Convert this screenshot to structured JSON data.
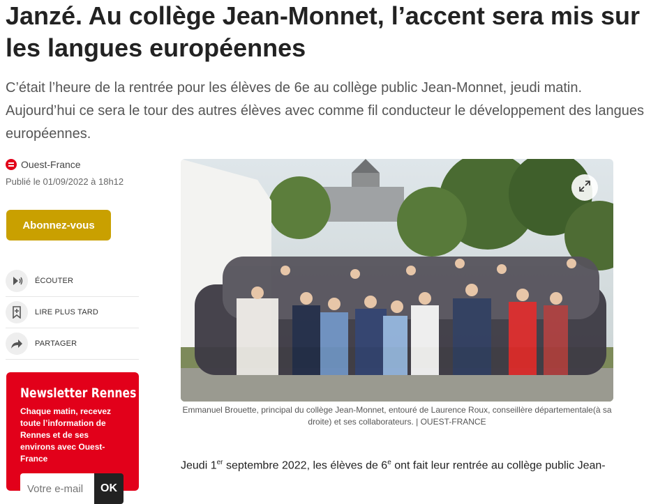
{
  "article": {
    "title": "Janzé. Au collège Jean-Monnet, l’accent sera mis sur les langues européennes",
    "lead": "C’était l’heure de la rentrée pour les élèves de 6e au collège public Jean-Monnet, jeudi matin. Aujourd’hui ce sera le tour des autres élèves avec comme fil conducteur le développement des langues européennes.",
    "source": "Ouest-France",
    "published": "Publié le 01/09/2022 à 18h12",
    "caption": "Emmanuel Brouette, principal du collège Jean-Monnet, entouré de Laurence Roux, conseillère départementale(à sa droite) et ses collaborateurs. | OUEST-FRANCE",
    "body_start": "Jeudi 1",
    "body_sup1": "er",
    "body_mid": " septembre 2022, les élèves de 6",
    "body_sup2": "e",
    "body_end": " ont fait leur rentrée au collège public Jean-"
  },
  "subscribe_label": "Abonnez-vous",
  "actions": [
    {
      "label": "ÉCOUTER",
      "icon": "play-audio-icon"
    },
    {
      "label": "LIRE PLUS TARD",
      "icon": "bookmark-add-icon"
    },
    {
      "label": "PARTAGER",
      "icon": "share-arrow-icon"
    }
  ],
  "newsletter": {
    "title": "Newsletter Rennes",
    "text_prefix": "Chaque matin, recevez toute l’information de Rennes et de ses environs avec ",
    "text_brand": "Ouest-France",
    "placeholder": "Votre e-mail",
    "button": "OK"
  },
  "colors": {
    "brand_red": "#e2001a",
    "subscribe_gold": "#c9a000"
  }
}
